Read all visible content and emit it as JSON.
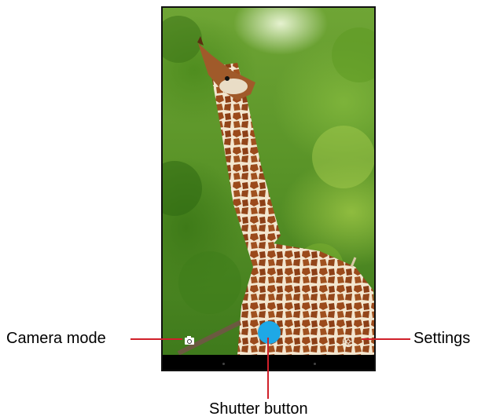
{
  "callouts": {
    "camera_mode": "Camera mode",
    "settings": "Settings",
    "shutter_button": "Shutter button"
  },
  "icons": {
    "camera_mode": "camera-icon",
    "shutter": "shutter-button",
    "settings": "settings-icon"
  },
  "colors": {
    "callout_line": "#d0202a",
    "shutter": "#1ea8e6"
  }
}
